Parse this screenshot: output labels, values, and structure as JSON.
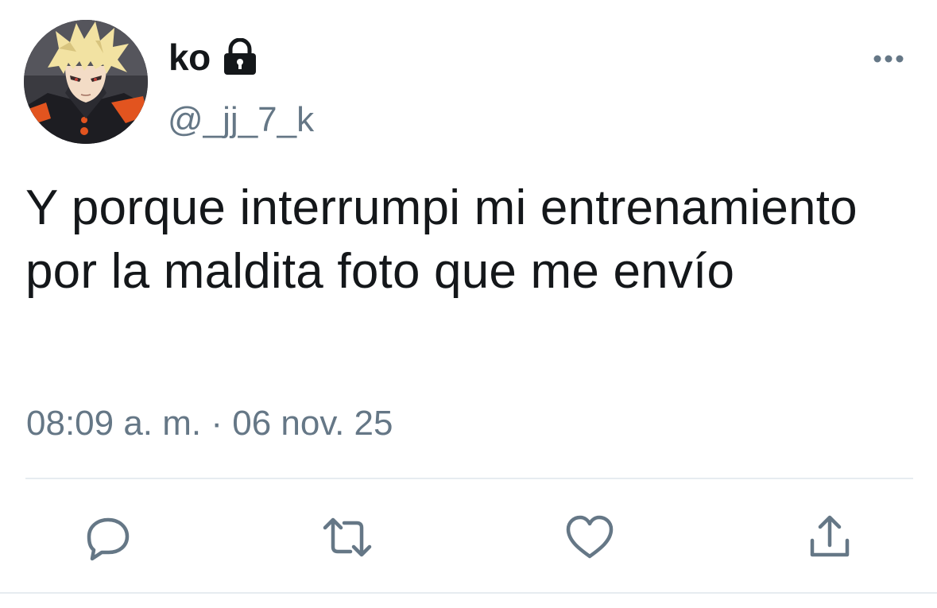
{
  "tweet": {
    "author": {
      "display_name": "ko",
      "handle": "@_jj_7_k",
      "protected_icon": "lock-icon",
      "avatar_icon": "anime-avatar"
    },
    "text": "Y porque interrumpi mi entrenamiento por la maldita foto que me envío",
    "timestamp": "08:09 a. m. · 06 nov. 25",
    "more_icon": "more-options-icon"
  },
  "actions": [
    {
      "name": "reply",
      "icon": "reply-icon"
    },
    {
      "name": "retweet",
      "icon": "retweet-icon"
    },
    {
      "name": "like",
      "icon": "heart-icon"
    },
    {
      "name": "share",
      "icon": "share-icon"
    }
  ],
  "colors": {
    "text_primary": "#14171a",
    "text_secondary": "#657786",
    "divider": "#e6ecf0",
    "icon": "#657786"
  }
}
